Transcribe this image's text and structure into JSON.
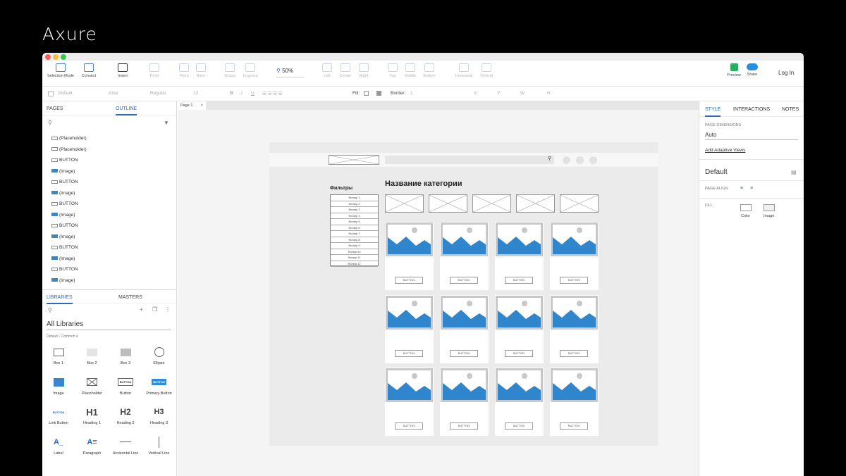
{
  "header_title": "Axure",
  "toolbar": {
    "items": [
      {
        "label": "Selection Mode"
      },
      {
        "label": "Connect"
      },
      {
        "label": "Insert"
      },
      {
        "label": "Point"
      },
      {
        "label": "Front"
      },
      {
        "label": "Back"
      },
      {
        "label": "Group"
      },
      {
        "label": "Ungroup"
      },
      {
        "label": "Left"
      },
      {
        "label": "Center"
      },
      {
        "label": "Right"
      },
      {
        "label": "Top"
      },
      {
        "label": "Middle"
      },
      {
        "label": "Bottom"
      },
      {
        "label": "Horizontal"
      },
      {
        "label": "Vertical"
      }
    ],
    "zoom": "50%",
    "preview": "Preview",
    "share": "Share",
    "login": "Log In"
  },
  "format": {
    "style": "Default",
    "font": "Arial",
    "weight": "Regular",
    "size": "13",
    "fill": "Fill:",
    "border": "Border:",
    "border_val": "1",
    "x": "X",
    "y": "Y",
    "w": "W",
    "h": "H"
  },
  "left": {
    "tab_pages": "PAGES",
    "tab_outline": "OUTLINE",
    "outline": [
      "(Placeholder)",
      "(Placeholder)",
      "BUTTON",
      "(Image)",
      "BUTTON",
      "(Image)",
      "BUTTON",
      "(Image)",
      "BUTTON",
      "(Image)",
      "BUTTON",
      "(Image)",
      "BUTTON",
      "(Image)"
    ],
    "tab_libraries": "LIBRARIES",
    "tab_masters": "MASTERS",
    "all_libraries": "All Libraries",
    "lib_path": "Default › Common ▾",
    "widgets": [
      "Box 1",
      "Box 2",
      "Box 3",
      "Ellipse",
      "Image",
      "Placeholder",
      "Button",
      "Primary Button",
      "Link Button",
      "Heading 1",
      "Heading 2",
      "Heading 3",
      "Label",
      "Paragraph",
      "Horizontal Line",
      "Vertical Line"
    ],
    "widget_glyphs": {
      "button": "BUTTON",
      "primary": "BUTTON",
      "link": "BUTTON",
      "h1": "H1",
      "h2": "H2",
      "h3": "H3"
    }
  },
  "canvas": {
    "page_tab": "Page 1",
    "filters_title": "Фильтры",
    "category_title": "Название категории",
    "filters": [
      "Фильтр 1",
      "Фильтр 2",
      "Фильтр 3",
      "Фильтр 4",
      "Фильтр 5",
      "Фильтр 6",
      "Фильтр 7",
      "Фильтр 8",
      "Фильтр 9",
      "Фильтр 10",
      "Фильтр 11",
      "Фильтр 12"
    ],
    "button_label": "BUTTON"
  },
  "right": {
    "tab_style": "STYLE",
    "tab_interactions": "INTERACTIONS",
    "tab_notes": "NOTES",
    "page_dimensions": "PAGE DIMENSIONS",
    "dimension_value": "Auto",
    "adaptive": "Add Adaptive Views",
    "style_name": "Default",
    "page_align": "PAGE ALIGN",
    "fill": "FILL",
    "fill_color": "Color",
    "fill_image": "Image"
  },
  "colors": {
    "accent": "#2a6ac5",
    "image_blue": "#3a86cc",
    "preview_green": "#27ae60"
  }
}
